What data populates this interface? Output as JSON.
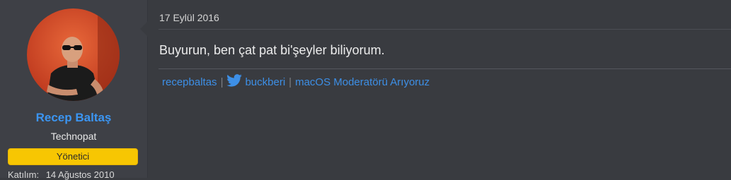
{
  "user": {
    "name": "Recep Baltaş",
    "title": "Technopat",
    "role": "Yönetici",
    "joined_label": "Katılım:",
    "joined_value": "14 Ağustos 2010",
    "avatar_icon": "user-avatar-photo"
  },
  "post": {
    "date": "17 Eylül 2016",
    "message": "Buyurun, ben çat pat bi'şeyler biliyorum."
  },
  "signature": {
    "link1": "recepbaltas",
    "separator": "|",
    "twitter_icon": "twitter-bird-icon",
    "link2": "buckberi",
    "link3": "macOS Moderatörü Arıyoruz"
  },
  "colors": {
    "background": "#393b40",
    "username": "#3b95f2",
    "badge": "#f7c602",
    "link": "#3d8fe6"
  }
}
